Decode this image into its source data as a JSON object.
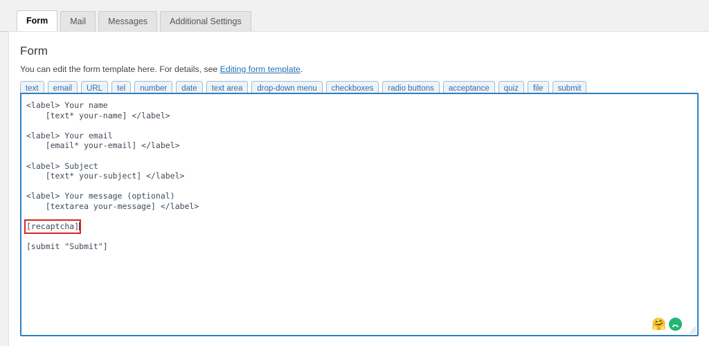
{
  "tabs": [
    {
      "label": "Form",
      "active": true
    },
    {
      "label": "Mail",
      "active": false
    },
    {
      "label": "Messages",
      "active": false
    },
    {
      "label": "Additional Settings",
      "active": false
    }
  ],
  "panel": {
    "title": "Form",
    "description_before": "You can edit the form template here. For details, see ",
    "description_link": "Editing form template",
    "description_after": "."
  },
  "tag_buttons": [
    "text",
    "email",
    "URL",
    "tel",
    "number",
    "date",
    "text area",
    "drop-down menu",
    "checkboxes",
    "radio buttons",
    "acceptance",
    "quiz",
    "file",
    "submit"
  ],
  "editor": {
    "code_part1": "<label> Your name\n    [text* your-name] </label>\n\n<label> Your email\n    [email* your-email] </label>\n\n<label> Subject\n    [text* your-subject] </label>\n\n<label> Your message (optional)\n    [textarea your-message] </label>\n\n",
    "highlighted_tag": "[recaptcha]",
    "code_part2": "\n\n[submit \"Submit\"]",
    "highlight_color": "#e02020",
    "border_color": "#2c7fbf"
  },
  "corner": {
    "emoji_icon": "face-emoji-icon",
    "emoji_glyph": "🤗",
    "undo_icon": "undo-arrow-icon",
    "undo_color": "#22b573",
    "resize_handle": "resize-handle-icon"
  }
}
